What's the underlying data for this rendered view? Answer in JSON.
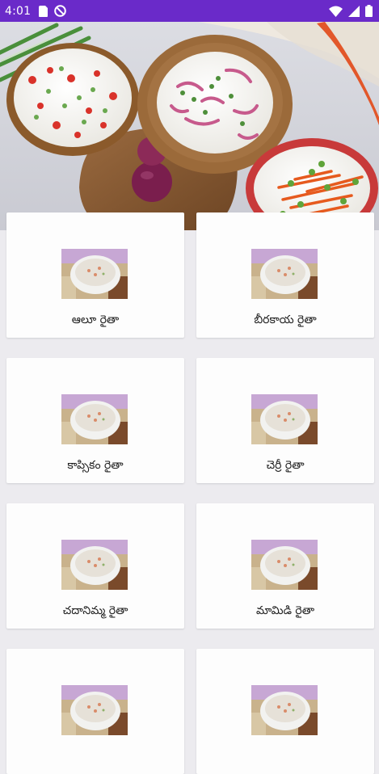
{
  "status_bar": {
    "time": "4:01",
    "background": "#6a2ac9",
    "left_icons": [
      "sim-card-icon",
      "do-not-disturb-icon"
    ],
    "right_icons": [
      "wifi-icon",
      "cellular-signal-icon",
      "battery-icon"
    ]
  },
  "hero": {
    "image": "raita-bowls-hero-image"
  },
  "recipes": [
    {
      "name": "ఆలూ రైతా",
      "thumb": "raita-bowl-thumbnail"
    },
    {
      "name": "బీరకాయ రైతా",
      "thumb": "raita-bowl-thumbnail"
    },
    {
      "name": "కాప్సికం రైతా",
      "thumb": "raita-bowl-thumbnail"
    },
    {
      "name": "చెర్రీ రైతా",
      "thumb": "raita-bowl-thumbnail"
    },
    {
      "name": "చదానిమ్మ రైతా",
      "thumb": "raita-bowl-thumbnail"
    },
    {
      "name": "మామిడి రైతా",
      "thumb": "raita-bowl-thumbnail"
    },
    {
      "name": "",
      "thumb": "raita-bowl-thumbnail"
    },
    {
      "name": "",
      "thumb": "raita-bowl-thumbnail"
    }
  ]
}
